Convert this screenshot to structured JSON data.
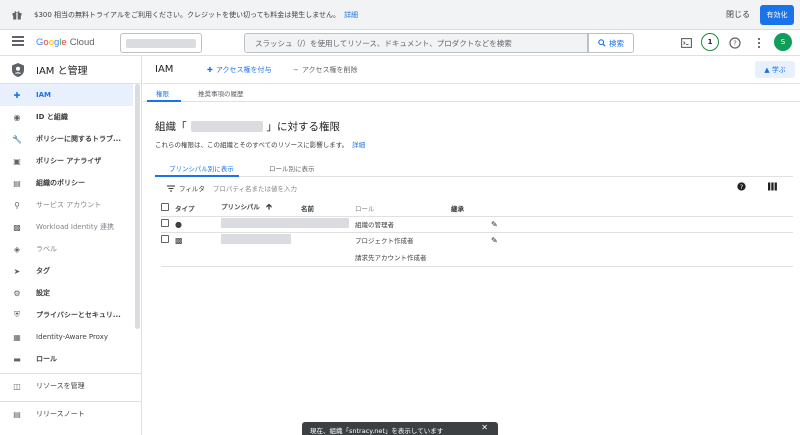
{
  "banner": {
    "message": "$300 相当の無料トライアルをご利用ください。クレジットを使い切っても料金は発生しません。",
    "link": "詳細",
    "close": "閉じる",
    "activate": "有効化"
  },
  "topbar": {
    "logo_google": "Google",
    "logo_cloud": "Cloud",
    "search_placeholder": "スラッシュ（/）を使用してリソース、ドキュメント、プロダクトなどを検索",
    "search_button": "検索",
    "notification_count": "1",
    "avatar_initial": "S"
  },
  "sidebar": {
    "title": "IAM と管理",
    "items": [
      {
        "label": "IAM",
        "icon": "person-add-icon"
      },
      {
        "label": "ID と組織",
        "icon": "account-circle-icon"
      },
      {
        "label": "ポリシーに関するトラブ...",
        "icon": "wrench-icon"
      },
      {
        "label": "ポリシー アナライザ",
        "icon": "search-doc-icon"
      },
      {
        "label": "組織のポリシー",
        "icon": "list-icon"
      },
      {
        "label": "サービス アカウント",
        "icon": "key-icon"
      },
      {
        "label": "Workload Identity 連携",
        "icon": "workload-icon"
      },
      {
        "label": "ラベル",
        "icon": "label-icon"
      },
      {
        "label": "タグ",
        "icon": "tag-icon"
      },
      {
        "label": "設定",
        "icon": "gear-icon"
      },
      {
        "label": "プライバシーとセキュリ...",
        "icon": "shield-icon"
      },
      {
        "label": "Identity-Aware Proxy",
        "icon": "proxy-icon"
      },
      {
        "label": "ロール",
        "icon": "roles-icon"
      }
    ],
    "manage_resources": "リソースを管理",
    "release_notes": "リリースノート"
  },
  "main": {
    "title": "IAM",
    "grant_access": "アクセス権を付与",
    "revoke_access": "アクセス権を削除",
    "learn": "学ぶ",
    "tabs": [
      "権限",
      "推奨事項の履歴"
    ],
    "heading_prefix": "組織「",
    "heading_suffix": "」に対する権限",
    "subtitle": "これらの権限は、この組織とそのすべてのリソースに影響します。",
    "subtitle_link": "詳細",
    "view_tabs": [
      "プリンシパル別に表示",
      "ロール別に表示"
    ],
    "filter_label": "フィルタ",
    "filter_placeholder": "プロパティ名または値を入力",
    "columns": [
      "タイプ",
      "プリンシパル",
      "名前",
      "ロール",
      "継承"
    ],
    "rows": [
      {
        "type_icon": "person-icon",
        "role": "組織の管理者"
      },
      {
        "type_icon": "building-icon",
        "role": "プロジェクト作成者"
      },
      {
        "type_icon": "",
        "role": "請求先アカウント作成者"
      }
    ]
  },
  "snackbar": {
    "text": "現在、組織「sntracy.net」を表示しています"
  }
}
